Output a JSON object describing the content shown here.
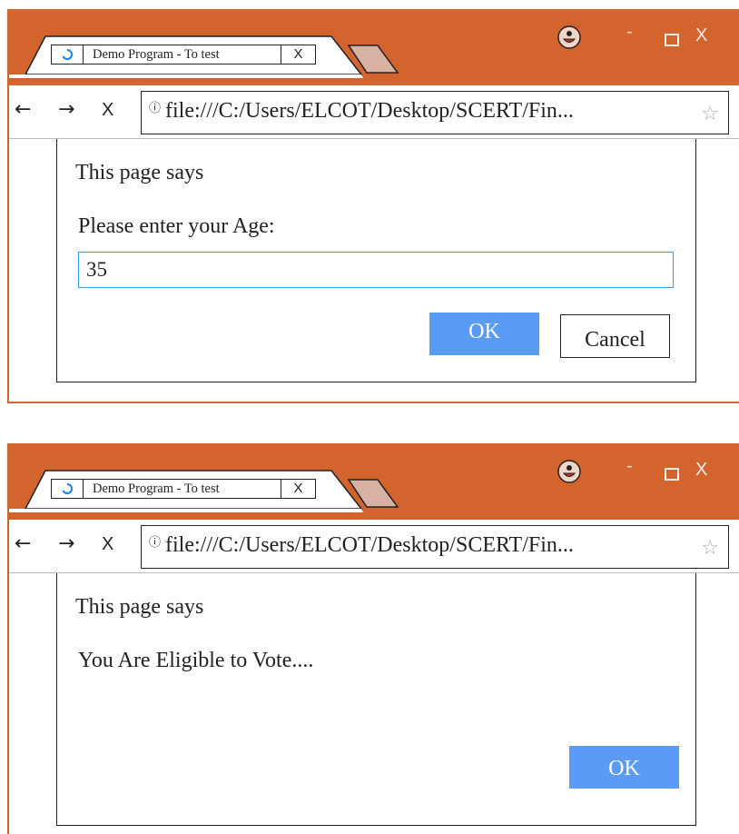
{
  "colors": {
    "titlebar": "#d3642e",
    "ok_button": "#5a9bf5",
    "input_focus": "#2ea6d9"
  },
  "windows": [
    {
      "tab": {
        "title": "Demo Program - To test",
        "close": "X",
        "icon": "reload-icon"
      },
      "window_controls": {
        "minimize": "-",
        "close": "X"
      },
      "nav": {
        "back": "←",
        "forward": "→",
        "stop": "X"
      },
      "address": {
        "info": "ⓘ",
        "url": "file:///C:/Users/ELCOT/Desktop/SCERT/Fin...",
        "star": "☆"
      },
      "dialog": {
        "title": "This page says",
        "message": "Please enter your Age:",
        "input_value": "35",
        "ok": "OK",
        "cancel": "Cancel"
      }
    },
    {
      "tab": {
        "title": "Demo Program - To test",
        "close": "X",
        "icon": "reload-icon"
      },
      "window_controls": {
        "minimize": "-",
        "close": "X"
      },
      "nav": {
        "back": "←",
        "forward": "→",
        "stop": "X"
      },
      "address": {
        "info": "ⓘ",
        "url": "file:///C:/Users/ELCOT/Desktop/SCERT/Fin...",
        "star": "☆"
      },
      "dialog": {
        "title": "This page says",
        "message": "You Are Eligible to Vote....",
        "ok": "OK"
      }
    }
  ]
}
